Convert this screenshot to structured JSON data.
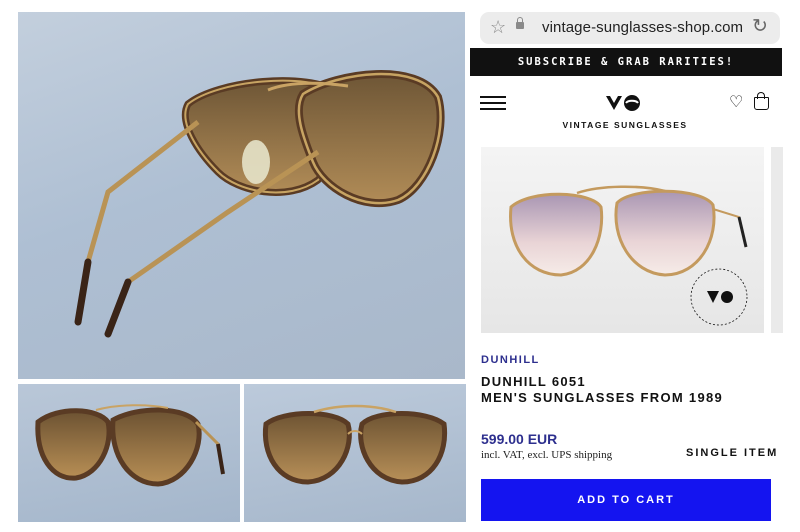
{
  "browser": {
    "url": "vintage-sunglasses-shop.com",
    "bookmark_icon": "star-icon",
    "secure_icon": "lock-icon",
    "reload_icon": "reload-icon"
  },
  "promo_banner": "SUBSCRIBE & GRAB RARITIES!",
  "header": {
    "brand_name": "VINTAGE SUNGLASSES",
    "menu_icon": "hamburger-icon",
    "wishlist_icon": "heart-icon",
    "cart_icon": "shopping-bag-icon"
  },
  "product": {
    "brand": "DUNHILL",
    "title_line1": "DUNHILL 6051",
    "title_line2": "MEN'S SUNGLASSES FROM 1989",
    "price": "599.00 EUR",
    "tax_note": "incl. VAT, excl. UPS shipping",
    "availability": "SINGLE ITEM",
    "add_to_cart_label": "ADD TO CART"
  },
  "colors": {
    "accent": "#1414f0",
    "brand_text": "#2d2f8e",
    "promo_bg": "#111111"
  }
}
